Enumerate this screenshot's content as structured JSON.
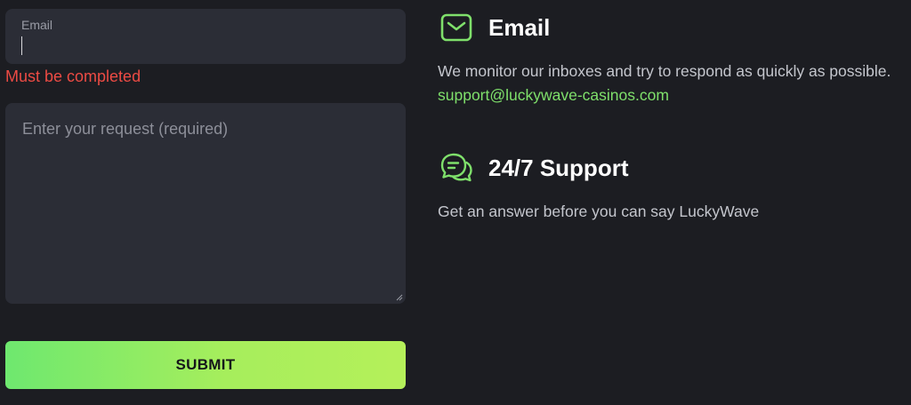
{
  "form": {
    "email_label": "Email",
    "email_value": "",
    "email_error": "Must be completed",
    "request_placeholder": "Enter your request (required)",
    "submit_label": "SUBMIT"
  },
  "info": {
    "email": {
      "icon": "envelope-icon",
      "title": "Email",
      "text": "We monitor our inboxes and try to respond as quickly as possible.",
      "address": "support@luckywave-casinos.com"
    },
    "support": {
      "icon": "chat-bubbles-icon",
      "title": "24/7 Support",
      "text": "Get an answer before you can say LuckyWave"
    }
  },
  "colors": {
    "background": "#1c1d22",
    "field": "#2b2d36",
    "accent_green": "#7fe06b",
    "error_red": "#ec4b44"
  }
}
